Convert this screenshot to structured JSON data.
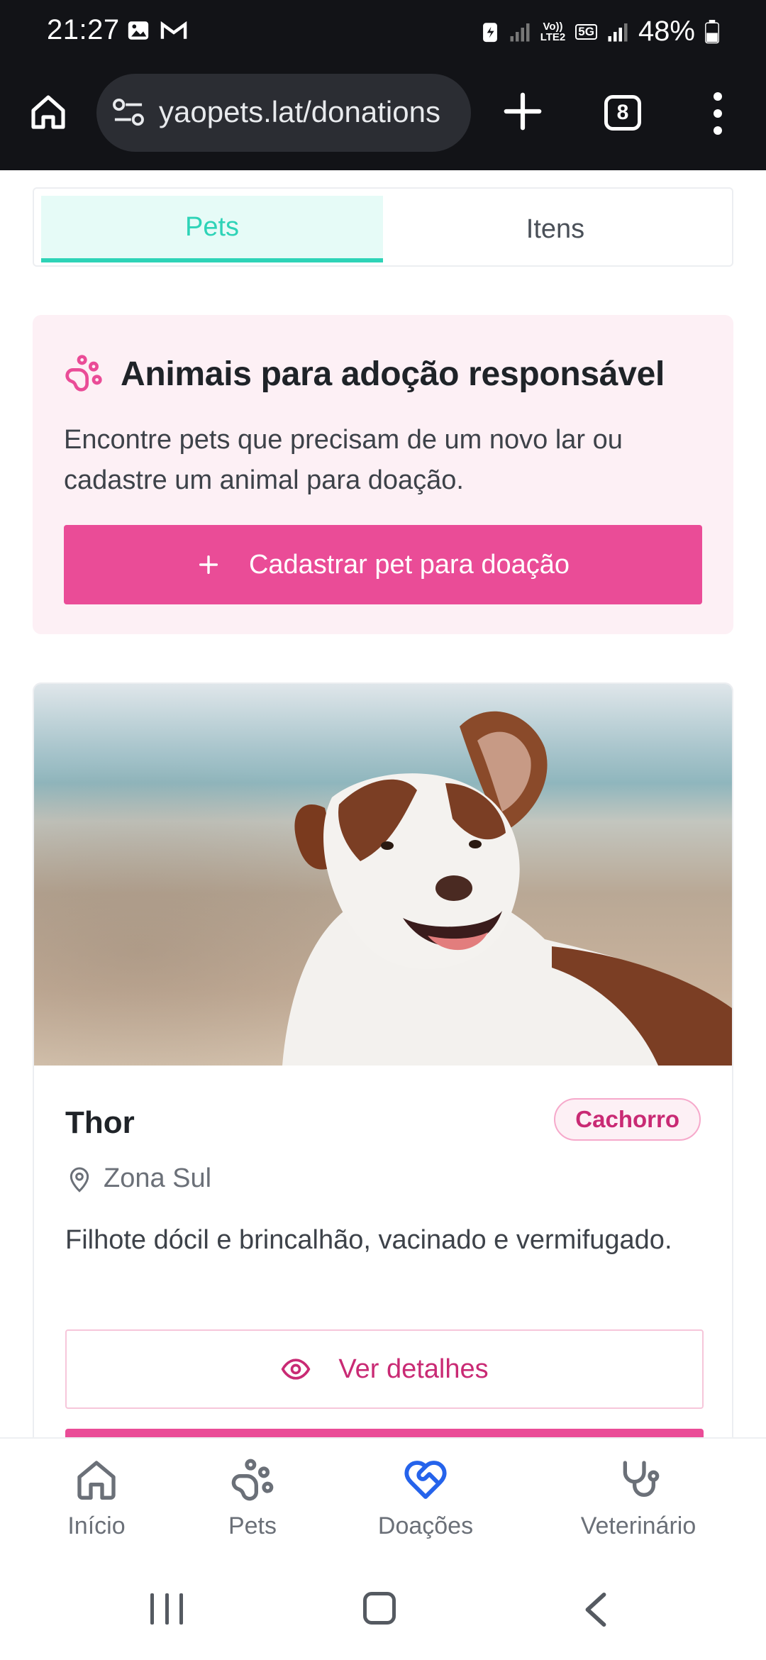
{
  "status_bar": {
    "time": "21:27",
    "network_label_top": "Vo))",
    "network_label_bottom": "LTE2",
    "network_5g": "5G",
    "battery_percent": "48%"
  },
  "browser": {
    "url": "yaopets.lat/donations",
    "tab_count": "8"
  },
  "tabs": [
    {
      "label": "Pets",
      "active": true
    },
    {
      "label": "Itens",
      "active": false
    }
  ],
  "hero": {
    "title": "Animais para adoção responsável",
    "description": "Encontre pets que precisam de um novo lar ou cadastre um animal para doação.",
    "button_label": "Cadastrar pet para doação",
    "button_icon": "plus-icon"
  },
  "pet": {
    "name": "Thor",
    "species_badge": "Cachorro",
    "location": "Zona Sul",
    "description": "Filhote dócil e brincalhão, vacinado e vermifugado.",
    "details_button": "Ver detalhes"
  },
  "bottom_nav": [
    {
      "label": "Início",
      "icon": "home-icon"
    },
    {
      "label": "Pets",
      "icon": "paw-icon"
    },
    {
      "label": "Doações",
      "icon": "heart-handshake-icon",
      "active": true
    },
    {
      "label": "Veterinário",
      "icon": "stethoscope-icon"
    }
  ],
  "colors": {
    "accent_pink": "#ea4c97",
    "accent_teal": "#2ed3b7",
    "active_nav_blue": "#2563eb",
    "chrome_bg": "#121317"
  }
}
